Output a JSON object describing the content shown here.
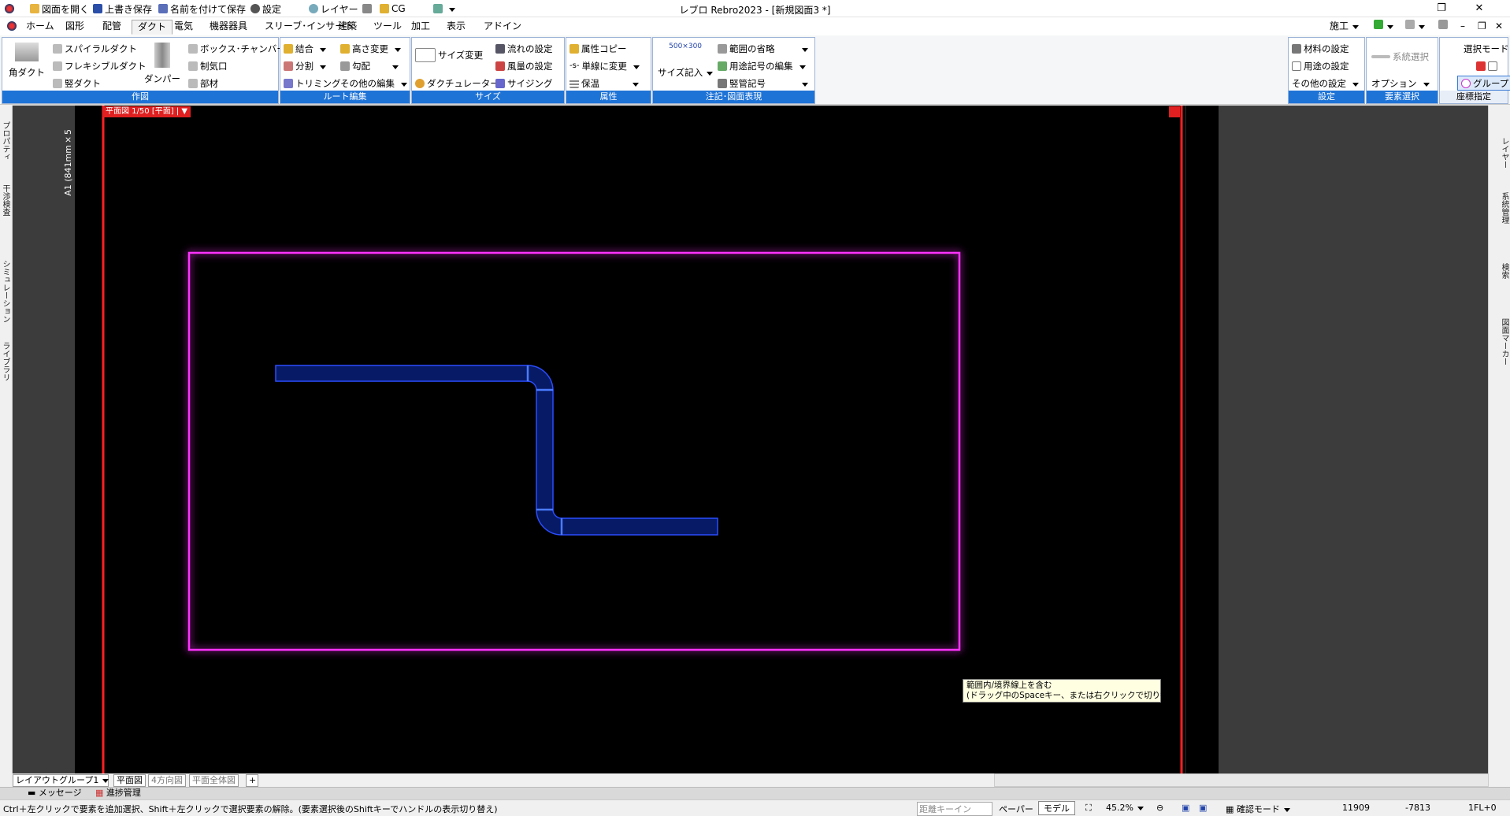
{
  "app": {
    "title": "レブロ Rebro2023 - [新規図面3 *]",
    "quick_access": [
      "図面を開く",
      "上書き保存",
      "名前を付けて保存",
      "設定",
      "レイヤー",
      "CG"
    ]
  },
  "menu": {
    "tabs": [
      "ホーム",
      "図形",
      "配管",
      "ダクト",
      "電気",
      "機器器具",
      "スリーブ･インサート",
      "建築",
      "ツール",
      "加工",
      "表示",
      "アドイン"
    ],
    "active": "ダクト",
    "right_label": "施工"
  },
  "ribbon": {
    "sakuzu": {
      "label": "作図",
      "big_kaku": "角ダクト",
      "spiral": "スパイラルダクト",
      "flexible": "フレキシブルダクト",
      "tate": "竪ダクト",
      "damper": "ダンパー",
      "box": "ボックス･チャンバー",
      "seikikou": "制気口",
      "buzai": "部材"
    },
    "route": {
      "label": "ルート編集",
      "ketsugou": "結合",
      "bunkatsu": "分割",
      "trimming": "トリミング",
      "takasa": "高さ変更",
      "koubai": "勾配",
      "sonota": "その他の編集"
    },
    "size": {
      "label": "サイズ",
      "size_henkou": "サイズ変更",
      "duct_calc": "ダクチュレーター",
      "nagare": "流れの設定",
      "fuuryou": "風量の設定",
      "sizing": "サイジング"
    },
    "zokusei": {
      "label": "属性",
      "copy": "属性コピー",
      "tansen": "単線に変更",
      "tansen_icon": "-s-",
      "hoon": "保温"
    },
    "chuuki": {
      "label": "注記･図面表現",
      "size_kinyu": "サイズ記入",
      "size_icon": "500×300",
      "hani": "範囲の省略",
      "youto_kigou": "用途記号の編集",
      "tatekan": "竪管記号"
    },
    "settei": {
      "label": "設定",
      "zairyou": "材料の設定",
      "youto": "用途の設定",
      "sonota": "その他の設定"
    },
    "youso": {
      "label": "要素選択",
      "keitou": "系統選択",
      "option": "オプション"
    },
    "zahyou": {
      "label": "座標指定",
      "mode": "選択モード",
      "group": "グループ"
    }
  },
  "left_tabs": [
    "プロパティ",
    "干渉検査",
    "シミュレーション",
    "ライブラリ"
  ],
  "right_tabs": [
    "レイヤー",
    "系統管理",
    "検索",
    "図面マーカー"
  ],
  "canvas": {
    "sheet_label": "A1 (841mm×5",
    "view_tag": "平面図 1/50 [平面] |",
    "tooltip_line1": "範囲内/境界線上を含む",
    "tooltip_line2": "(ドラッグ中のSpaceキー、または右クリックで切り替え)",
    "colors": {
      "selection": "#ff33ff",
      "duct": "#2a4dff",
      "view_frame": "#ff2020"
    }
  },
  "bottom": {
    "layout_group": "レイアウトグループ1",
    "tabs": [
      "平面図",
      "4方向図",
      "平面全体図"
    ],
    "msg_tabs": [
      "メッセージ",
      "進捗管理"
    ]
  },
  "status": {
    "hint": "Ctrl＋左クリックで要素を追加選択、Shift＋左クリックで選択要素の解除。(要素選択後のShiftキーでハンドルの表示切り替え)",
    "distance": "距離キーイン",
    "paper": "ペーパー",
    "model": "モデル",
    "zoom": "45.2%",
    "mode": "確認モード",
    "x": "11909",
    "y": "-7813",
    "fl": "1FL+0"
  }
}
